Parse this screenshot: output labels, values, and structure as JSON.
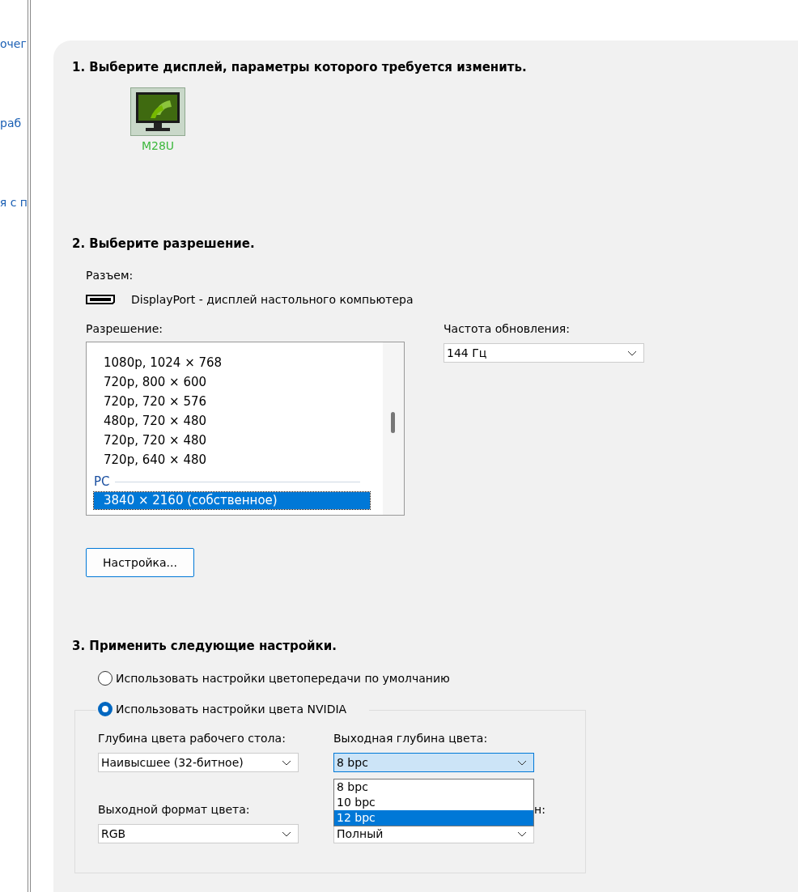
{
  "sidebar": {
    "links": [
      "очег",
      "раб",
      "я с п"
    ]
  },
  "step1": {
    "heading": "1. Выберите дисплей, параметры которого требуется изменить.",
    "displays": [
      {
        "name": "M28U",
        "selected": true
      }
    ]
  },
  "step2": {
    "heading": "2. Выберите разрешение.",
    "connector_label": "Разъем:",
    "connector": "DisplayPort - дисплей настольного компьютера",
    "resolution_label": "Разрешение:",
    "resolutions": [
      {
        "label": "1080p, 1024 × 768",
        "kind": "item",
        "selected": false
      },
      {
        "label": "720p, 800 × 600",
        "kind": "item",
        "selected": false
      },
      {
        "label": "720p, 720 × 576",
        "kind": "item",
        "selected": false
      },
      {
        "label": "480p, 720 × 480",
        "kind": "item",
        "selected": false
      },
      {
        "label": "720p, 720 × 480",
        "kind": "item",
        "selected": false
      },
      {
        "label": "720p, 640 × 480",
        "kind": "item",
        "selected": false
      },
      {
        "label": "PC",
        "kind": "group"
      },
      {
        "label": "3840 × 2160 (собственное)",
        "kind": "item",
        "selected": true
      }
    ],
    "refresh_label": "Частота обновления:",
    "refresh_value": "144 Гц",
    "customize_button": "Настройка..."
  },
  "step3": {
    "heading": "3. Применить следующие настройки.",
    "options": [
      {
        "label": "Использовать настройки цветопередачи по умолчанию",
        "selected": false
      },
      {
        "label": "Использовать настройки цвета NVIDIA",
        "selected": true
      }
    ],
    "fields": [
      {
        "label": "Глубина цвета рабочего стола:",
        "value": "Наивысшее (32-битное)",
        "open": false
      },
      {
        "label": "Выходная глубина цвета:",
        "value": "8 bpc",
        "open": true,
        "options": [
          {
            "label": "8 bpc",
            "highlighted": false
          },
          {
            "label": "10 bpc",
            "highlighted": false
          },
          {
            "label": "12 bpc",
            "highlighted": true
          }
        ]
      },
      {
        "label": "Выходной формат цвета:",
        "value": "RGB",
        "open": false
      },
      {
        "label": "н:",
        "value": "Полный",
        "open": false
      }
    ]
  }
}
